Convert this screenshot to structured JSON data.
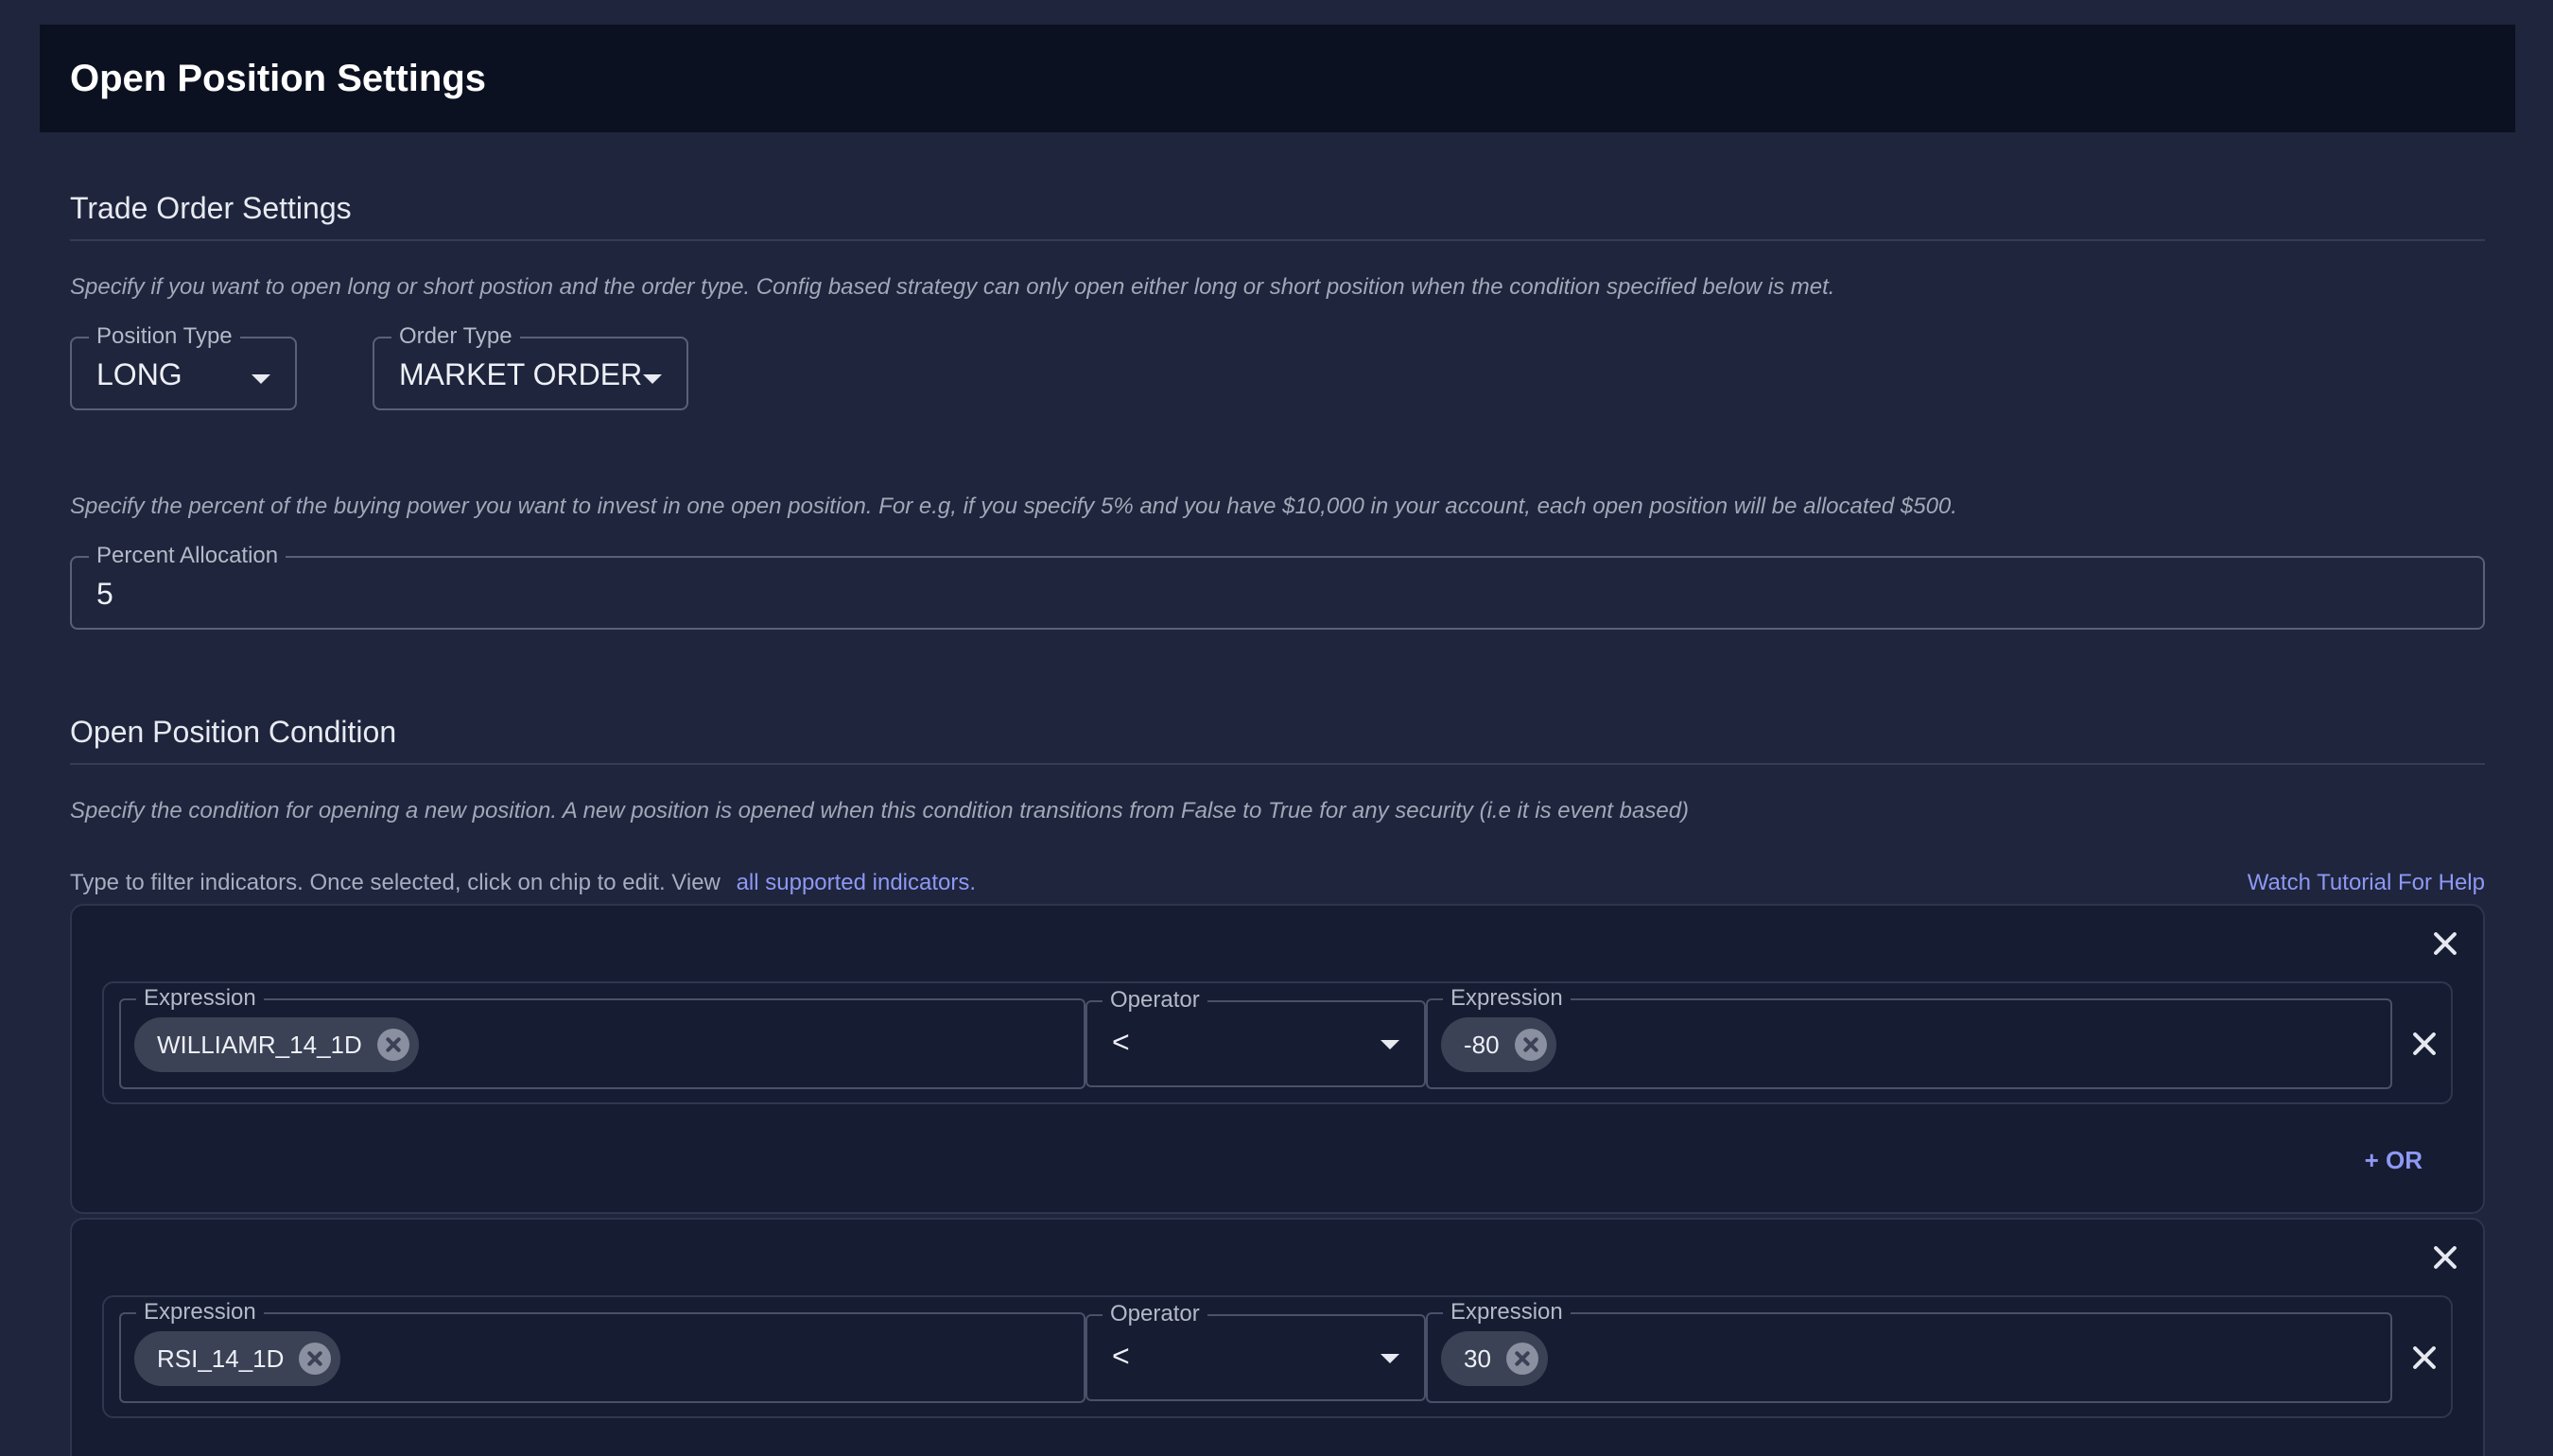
{
  "header": {
    "title": "Open Position Settings"
  },
  "trade_order": {
    "section_title": "Trade Order Settings",
    "description": "Specify if you want to open long or short postion and the order type. Config based strategy can only open either long or short position when the condition specified below is met.",
    "position_type": {
      "label": "Position Type",
      "value": "LONG"
    },
    "order_type": {
      "label": "Order Type",
      "value": "MARKET ORDER"
    },
    "allocation_description": "Specify the percent of the buying power you want to invest in one open position. For e.g, if you specify 5% and you have $10,000 in your account, each open position will be allocated $500.",
    "percent_allocation": {
      "label": "Percent Allocation",
      "value": "5"
    }
  },
  "open_condition": {
    "section_title": "Open Position Condition",
    "description": "Specify the condition for opening a new position. A new position is opened when this condition transitions from False to True for any security (i.e it is event based)",
    "hint_text": "Type to filter indicators. Once selected, click on chip to edit. View",
    "hint_link": "all supported indicators.",
    "help_link": "Watch Tutorial For Help",
    "or_label": "+ OR",
    "groups": [
      {
        "left": {
          "label": "Expression",
          "chip": "WILLIAMR_14_1D"
        },
        "operator": {
          "label": "Operator",
          "value": "<"
        },
        "right": {
          "label": "Expression",
          "chip": "-80"
        }
      },
      {
        "left": {
          "label": "Expression",
          "chip": "RSI_14_1D"
        },
        "operator": {
          "label": "Operator",
          "value": "<"
        },
        "right": {
          "label": "Expression",
          "chip": "30"
        }
      }
    ]
  }
}
